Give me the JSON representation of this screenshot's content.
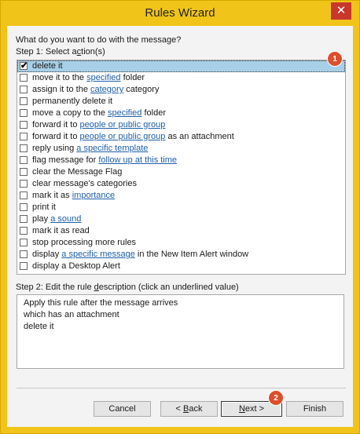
{
  "window": {
    "title": "Rules Wizard",
    "close_glyph": "✕"
  },
  "prompt": "What do you want to do with the message?",
  "step1": {
    "pre": "Step 1: Select a",
    "u": "c",
    "post": "tion(s)"
  },
  "actions": [
    {
      "checked": true,
      "selected": true,
      "segments": [
        {
          "text": "delete it",
          "link": false
        }
      ]
    },
    {
      "checked": false,
      "segments": [
        {
          "text": "move it to the ",
          "link": false
        },
        {
          "text": "specified",
          "link": true
        },
        {
          "text": " folder",
          "link": false
        }
      ]
    },
    {
      "checked": false,
      "segments": [
        {
          "text": "assign it to the ",
          "link": false
        },
        {
          "text": "category",
          "link": true
        },
        {
          "text": " category",
          "link": false
        }
      ]
    },
    {
      "checked": false,
      "segments": [
        {
          "text": "permanently delete it",
          "link": false
        }
      ]
    },
    {
      "checked": false,
      "segments": [
        {
          "text": "move a copy to the ",
          "link": false
        },
        {
          "text": "specified",
          "link": true
        },
        {
          "text": " folder",
          "link": false
        }
      ]
    },
    {
      "checked": false,
      "segments": [
        {
          "text": "forward it to ",
          "link": false
        },
        {
          "text": "people or public group",
          "link": true
        }
      ]
    },
    {
      "checked": false,
      "segments": [
        {
          "text": "forward it to ",
          "link": false
        },
        {
          "text": "people or public group",
          "link": true
        },
        {
          "text": " as an attachment",
          "link": false
        }
      ]
    },
    {
      "checked": false,
      "segments": [
        {
          "text": "reply using ",
          "link": false
        },
        {
          "text": "a specific template",
          "link": true
        }
      ]
    },
    {
      "checked": false,
      "segments": [
        {
          "text": "flag message for ",
          "link": false
        },
        {
          "text": "follow up at this time",
          "link": true
        }
      ]
    },
    {
      "checked": false,
      "segments": [
        {
          "text": "clear the Message Flag",
          "link": false
        }
      ]
    },
    {
      "checked": false,
      "segments": [
        {
          "text": "clear message's categories",
          "link": false
        }
      ]
    },
    {
      "checked": false,
      "segments": [
        {
          "text": "mark it as ",
          "link": false
        },
        {
          "text": "importance",
          "link": true
        }
      ]
    },
    {
      "checked": false,
      "segments": [
        {
          "text": "print it",
          "link": false
        }
      ]
    },
    {
      "checked": false,
      "segments": [
        {
          "text": "play ",
          "link": false
        },
        {
          "text": "a sound",
          "link": true
        }
      ]
    },
    {
      "checked": false,
      "segments": [
        {
          "text": "mark it as read",
          "link": false
        }
      ]
    },
    {
      "checked": false,
      "segments": [
        {
          "text": "stop processing more rules",
          "link": false
        }
      ]
    },
    {
      "checked": false,
      "segments": [
        {
          "text": "display ",
          "link": false
        },
        {
          "text": "a specific message",
          "link": true
        },
        {
          "text": " in the New Item Alert window",
          "link": false
        }
      ]
    },
    {
      "checked": false,
      "segments": [
        {
          "text": "display a Desktop Alert",
          "link": false
        }
      ]
    }
  ],
  "step2": {
    "pre": "Step 2: Edit the rule ",
    "u": "d",
    "post": "escription (click an underlined value)"
  },
  "description_lines": [
    "Apply this rule after the message arrives",
    "which has an attachment",
    "delete it"
  ],
  "buttons": {
    "cancel": "Cancel",
    "back": {
      "pre": "< ",
      "u": "B",
      "post": "ack"
    },
    "next": {
      "u": "N",
      "post": "ext >"
    },
    "finish": "Finish"
  },
  "badges": {
    "one": "1",
    "two": "2"
  },
  "colors": {
    "frame": "#f0c419",
    "badge": "#dc4f2c",
    "link": "#1f5fa8",
    "selection": "#a8cfe8"
  }
}
